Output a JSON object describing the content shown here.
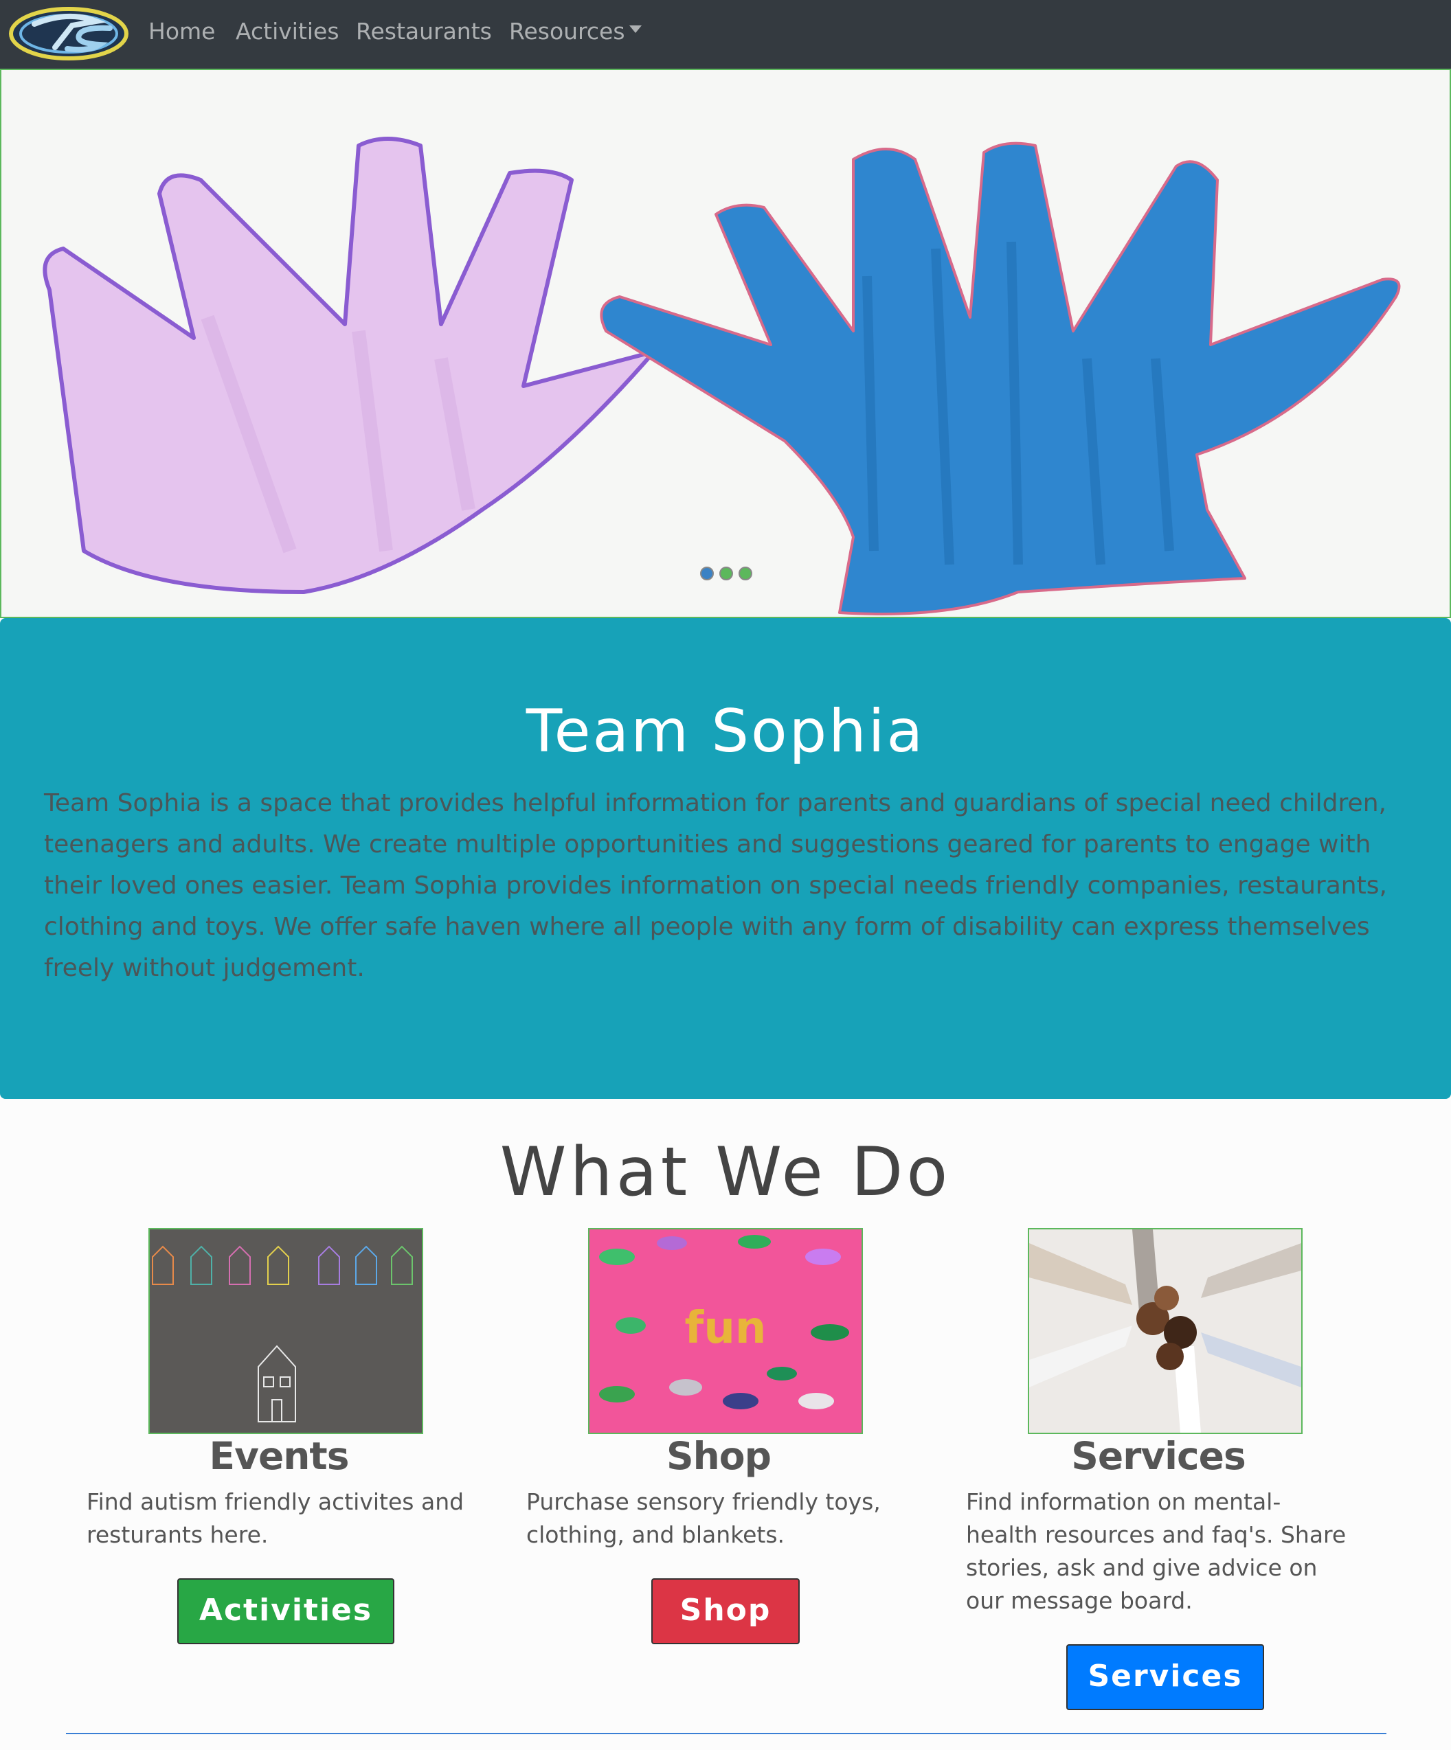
{
  "navbar": {
    "logo_icon": "ts-logo",
    "items": [
      {
        "label": "Home"
      },
      {
        "label": "Activities"
      },
      {
        "label": "Restaurants"
      },
      {
        "label": "Resources",
        "dropdown": true
      }
    ]
  },
  "carousel": {
    "slides": 3,
    "active_index": 0,
    "colors": {
      "left_hand": "#e5c4ee",
      "left_outline": "#8a5cd1",
      "right_hand": "#2f86cf",
      "right_outline": "#d86a8a"
    }
  },
  "jumbotron": {
    "title": "Team Sophia",
    "text": "Team Sophia is a space that provides helpful information for parents and guardians of special need children, teenagers and adults. We create multiple opportunities and suggestions geared for parents to engage with their loved ones easier. Team Sophia provides information on special needs friendly companies, restaurants, clothing and toys. We offer safe haven where all people with any form of disability can express themselves freely without judgement.",
    "bg_color": "#17a2b8"
  },
  "what_we_do": {
    "title": "What We Do",
    "cards": [
      {
        "title": "Events",
        "text": "Find autism friendly activites and resturants here.",
        "button": "Activities",
        "button_color": "#28a745"
      },
      {
        "title": "Shop",
        "text": "Purchase sensory friendly toys, clothing, and blankets.",
        "button": "Shop",
        "button_color": "#dc3545",
        "image_word": "fun"
      },
      {
        "title": "Services",
        "text": "Find information on mental-health resources and faq's. Share stories, ask and give advice on our message board.",
        "button": "Services",
        "button_color": "#007bff"
      }
    ]
  }
}
